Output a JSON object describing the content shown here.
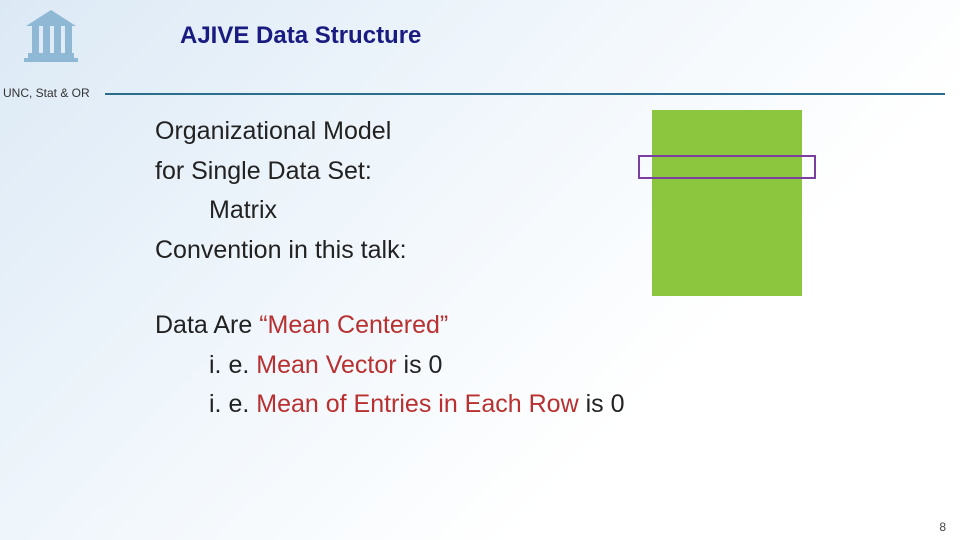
{
  "header": {
    "title": "AJIVE Data Structure",
    "affiliation": "UNC, Stat & OR"
  },
  "body": {
    "line1": "Organizational Model",
    "line2": "for Single Data Set:",
    "line3": "Matrix",
    "line4": "Convention in this talk:",
    "line5_pre": "Data Are ",
    "line5_hl": "“Mean Centered”",
    "line6_pre": "i. e. ",
    "line6_hl": "Mean Vector",
    "line6_post": " is 0",
    "line7_pre": "i. e. ",
    "line7_hl": "Mean of Entries in Each Row",
    "line7_post": " is 0"
  },
  "diagram": {
    "block_color": "#8cc63f",
    "row_outline_color": "#7a3fa0"
  },
  "page_number": "8"
}
